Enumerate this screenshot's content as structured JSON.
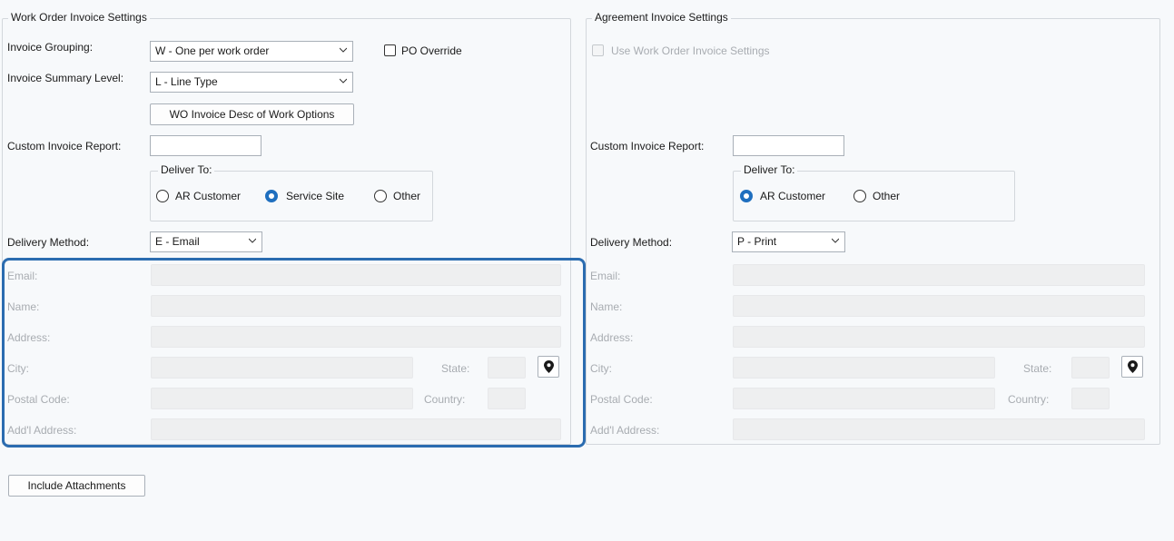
{
  "wo_section": {
    "title": "Work Order Invoice Settings",
    "invoice_grouping_label": "Invoice Grouping:",
    "invoice_grouping_value": "W - One per work order",
    "po_override_label": "PO Override",
    "invoice_summary_label": "Invoice Summary Level:",
    "invoice_summary_value": "L - Line Type",
    "desc_options_button": "WO Invoice Desc of Work Options",
    "custom_report_label": "Custom Invoice Report:",
    "custom_report_value": "",
    "deliver_to": {
      "legend": "Deliver To:",
      "options": [
        "AR Customer",
        "Service Site",
        "Other"
      ],
      "selected": "Service Site"
    },
    "delivery_method_label": "Delivery Method:",
    "delivery_method_value": "E - Email",
    "address": {
      "email_label": "Email:",
      "name_label": "Name:",
      "address_label": "Address:",
      "city_label": "City:",
      "state_label": "State:",
      "postal_label": "Postal Code:",
      "country_label": "Country:",
      "addl_label": "Add'l Address:"
    }
  },
  "agreement_section": {
    "title": "Agreement Invoice Settings",
    "use_wo_settings_label": "Use Work Order Invoice Settings",
    "custom_report_label": "Custom Invoice Report:",
    "custom_report_value": "",
    "deliver_to": {
      "legend": "Deliver To:",
      "options": [
        "AR Customer",
        "Other"
      ],
      "selected": "AR Customer"
    },
    "delivery_method_label": "Delivery Method:",
    "delivery_method_value": "P - Print",
    "address": {
      "email_label": "Email:",
      "name_label": "Name:",
      "address_label": "Address:",
      "city_label": "City:",
      "state_label": "State:",
      "postal_label": "Postal Code:",
      "country_label": "Country:",
      "addl_label": "Add'l Address:"
    }
  },
  "include_attachments_button": "Include Attachments",
  "colors": {
    "accent": "#1f6fbf",
    "highlight": "#2b6cb0",
    "disabled_text": "#a8acb1",
    "disabled_field": "#eeeff0"
  }
}
